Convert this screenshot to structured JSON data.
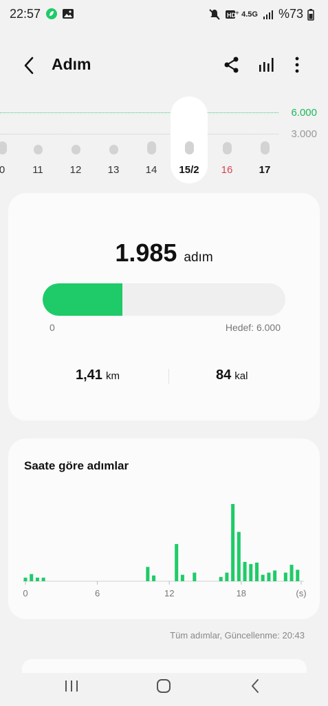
{
  "status": {
    "time": "22:57",
    "network": "4.5G",
    "battery": "%73"
  },
  "header": {
    "title": "Adım"
  },
  "days": {
    "goal_high": "6.000",
    "goal_low": "3.000",
    "items": [
      {
        "label": "0",
        "level": 0.35
      },
      {
        "label": "11",
        "level": 0.1
      },
      {
        "label": "12",
        "level": 0.1
      },
      {
        "label": "13",
        "level": 0.1
      },
      {
        "label": "14",
        "level": 0.33
      },
      {
        "label": "15/2",
        "level": 0.33
      },
      {
        "label": "16",
        "level": 0.28
      },
      {
        "label": "17",
        "level": 0.33
      }
    ]
  },
  "summary": {
    "steps": "1.985",
    "steps_unit": "adım",
    "progress": 0.33,
    "bar_min": "0",
    "bar_goal": "Hedef: 6.000",
    "distance": "1,41",
    "distance_unit": "km",
    "calories": "84",
    "calories_unit": "kal"
  },
  "hourly": {
    "title": "Saate göre adımlar",
    "footer": "Tüm adımlar, Güncellenme: 20:43"
  },
  "chart_data": {
    "type": "bar",
    "title": "Saate göre adımlar",
    "xlabel": "(s)",
    "x_ticks": [
      "0",
      "6",
      "12",
      "18"
    ],
    "xlim": [
      0,
      23
    ],
    "x": [
      0,
      0.5,
      1,
      1.5,
      10.2,
      10.7,
      12.6,
      13.1,
      14.1,
      16.3,
      16.8,
      17.3,
      17.8,
      18.3,
      18.8,
      19.3,
      19.8,
      20.3,
      20.8,
      21.7,
      22.2,
      22.7
    ],
    "values": [
      50,
      100,
      50,
      50,
      200,
      80,
      520,
      90,
      120,
      60,
      120,
      1080,
      690,
      270,
      240,
      260,
      90,
      120,
      150,
      120,
      230,
      160
    ],
    "color": "#1fcb68"
  },
  "nav": {
    "recent": "recent-apps",
    "home": "home",
    "back": "back"
  }
}
